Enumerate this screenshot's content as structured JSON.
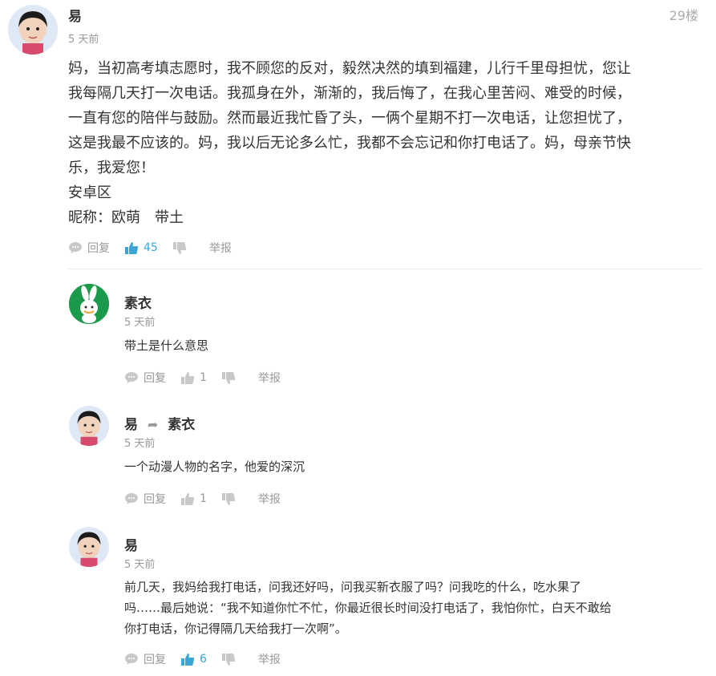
{
  "main": {
    "user": "易",
    "time": "5 天前",
    "floor": "29楼",
    "lines": [
      "妈，当初高考填志愿时，我不顾您的反对，毅然决然的填到福建，儿行千里母担忧，您让",
      "我每隔几天打一次电话。我孤身在外，渐渐的，我后悔了，在我心里苦闷、难受的时候，",
      "一直有您的陪伴与鼓励。然而最近我忙昏了头，一俩个星期不打一次电话，让您担忧了，",
      "这是我最不应该的。妈，我以后无论多么忙，我都不会忘记和你打电话了。妈，母亲节快",
      "乐，我爱您！",
      "安卓区",
      "昵称：欧萌　带土"
    ],
    "reply_label": "回复",
    "likes": "45",
    "report_label": "举报"
  },
  "replies": [
    {
      "user": "素衣",
      "target": "",
      "time": "5 天前",
      "lines": [
        "带土是什么意思"
      ],
      "reply_label": "回复",
      "likes": "1",
      "report_label": "举报"
    },
    {
      "user": "易",
      "target": "素衣",
      "time": "5 天前",
      "lines": [
        "一个动漫人物的名字，他爱的深沉"
      ],
      "reply_label": "回复",
      "likes": "1",
      "report_label": "举报"
    },
    {
      "user": "易",
      "target": "",
      "time": "5 天前",
      "lines": [
        "前几天，我妈给我打电话，问我还好吗，问我买新衣服了吗？问我吃的什么，吃水果了",
        "吗……最后她说：“我不知道你忙不忙，你最近很长时间没打电话了，我怕你忙，白天不敢给",
        "你打电话，你记得隔几天给我打一次啊”。"
      ],
      "reply_label": "回复",
      "likes": "6",
      "report_label": "举报"
    }
  ],
  "colors": {
    "accent": "#3aa6d6",
    "muted": "#999999",
    "avatar_green": "#1a9a4a"
  },
  "icons": [
    "comment-icon",
    "thumbs-up-icon",
    "thumbs-down-icon",
    "reply-arrow-icon",
    "rabbit-avatar"
  ]
}
